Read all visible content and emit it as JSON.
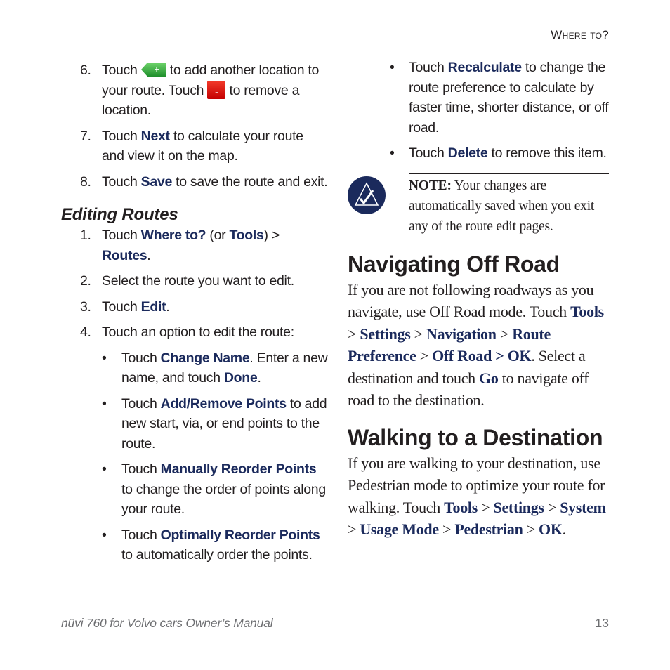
{
  "header": {
    "title": "Where to?"
  },
  "left": {
    "steps_a": [
      {
        "num": "6.",
        "parts": [
          "Touch ",
          "add-icon",
          " to add another location to your route. Touch ",
          "remove-icon",
          " to remove a location."
        ]
      },
      {
        "num": "7.",
        "pre": "Touch ",
        "bold": "Next",
        "post": " to calculate your route and view it on the map."
      },
      {
        "num": "8.",
        "pre": "Touch ",
        "bold": "Save",
        "post": " to save the route and exit."
      }
    ],
    "step6": {
      "num": "6.",
      "t1": "Touch ",
      "t2": " to add another location to your route. Touch ",
      "t3": " to remove a location.",
      "add_icon_symbol": "+",
      "remove_icon_symbol": "-"
    },
    "step7": {
      "num": "7.",
      "t1": "Touch ",
      "b1": "Next",
      "t2": " to calculate your route and view it on the map."
    },
    "step8": {
      "num": "8.",
      "t1": "Touch ",
      "b1": "Save",
      "t2": " to save the route and exit."
    },
    "editing_heading": "Editing Routes",
    "edit1": {
      "num": "1.",
      "t1": "Touch ",
      "b1": "Where to?",
      "t2": " (or ",
      "b2": "Tools",
      "t3": ") > ",
      "b3": "Routes",
      "t4": "."
    },
    "edit2": {
      "num": "2.",
      "t1": "Select the route you want to edit."
    },
    "edit3": {
      "num": "3.",
      "t1": "Touch ",
      "b1": "Edit",
      "t2": "."
    },
    "edit4": {
      "num": "4.",
      "t1": "Touch an option to edit the route:"
    },
    "bullets": [
      {
        "t1": "Touch ",
        "b1": "Change Name",
        "t2": ". Enter a new name, and touch ",
        "b2": "Done",
        "t3": "."
      },
      {
        "t1": "Touch ",
        "b1": "Add/Remove Points",
        "t2": " to add new start, via, or end points to the route."
      },
      {
        "t1": "Touch ",
        "b1": "Manually Reorder Points",
        "t2": " to change the order of points along your route."
      },
      {
        "t1": "Touch ",
        "b1": "Optimally Reorder Points",
        "t2": " to automatically order the points."
      }
    ]
  },
  "right": {
    "bullets": [
      {
        "t1": "Touch ",
        "b1": "Recalculate",
        "t2": " to change the route preference to calculate by faster time, shorter distance, or off road."
      },
      {
        "t1": "Touch ",
        "b1": "Delete",
        "t2": " to remove this item."
      }
    ],
    "note": {
      "label": "NOTE:",
      "text": " Your changes are automatically saved when you exit any of the route edit pages."
    },
    "offroad": {
      "heading": "Navigating Off Road",
      "t1": "If you are not following roadways as you navigate, use Off Road mode. Touch ",
      "b1": "Tools",
      "s1": " > ",
      "b2": "Settings",
      "s2": " > ",
      "b3": "Navigation",
      "s3": " > ",
      "b4": "Route Preference",
      "s4": " > ",
      "b5": "Off Road > OK",
      "t2": ". Select a destination and touch ",
      "b6": "Go",
      "t3": " to navigate off road to the destination."
    },
    "walking": {
      "heading": "Walking to a Destination",
      "t1": "If you are walking to your destination, use Pedestrian mode to optimize your route for walking. Touch ",
      "b1": "Tools",
      "s1": " > ",
      "b2": "Settings",
      "s2": " > ",
      "b3": "System",
      "s3": " > ",
      "b4": "Usage Mode",
      "s4": " > ",
      "b5": "Pedestrian",
      "s5": " > ",
      "b6": "OK",
      "t2": "."
    }
  },
  "footer": {
    "manual_title": "nüvi 760 for Volvo cars Owner’s Manual",
    "page_number": "13"
  },
  "colors": {
    "link_blue": "#1b2a5c",
    "note_icon_blue": "#1b2a5c",
    "add_green": "#3aa845",
    "remove_red": "#d50f0f"
  }
}
